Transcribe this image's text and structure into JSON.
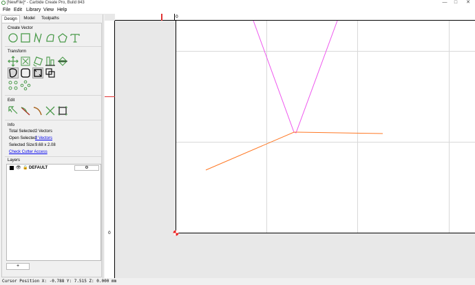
{
  "window": {
    "title": "[NewFile]* - Carbide Create Pro, Build 843",
    "min": "—",
    "max": "□",
    "close": "✕"
  },
  "menu": [
    "File",
    "Edit",
    "Library",
    "View",
    "Help"
  ],
  "tabs": [
    "Design",
    "Model",
    "Toolpaths"
  ],
  "sections": {
    "create_vector": "Create Vector",
    "transform": "Transform",
    "edit": "Edit",
    "info": "Info",
    "layers": "Layers"
  },
  "info": {
    "total_selected_label": "Total Selected:",
    "total_selected_value": "2 Vectors",
    "open_selected_label": "Open Selected:",
    "open_selected_value": "2 Vectors",
    "selected_size_label": "Selected Size:",
    "selected_size_value": "9.68 x 2.08",
    "check_cutter_access": "Check Cutter Access"
  },
  "layers": [
    {
      "name": "DEFAULT",
      "color": "#000000"
    }
  ],
  "add_layer_label": "+",
  "rulers": {
    "top_zero": "0",
    "left_zero": "0"
  },
  "status": "Cursor Position X: -0.788 Y: 7.515 Z: 0.000 mm",
  "colors": {
    "magenta_vector": "#ee55ee",
    "orange_vector": "#ff7722",
    "tool_green": "#4a9a4a"
  }
}
